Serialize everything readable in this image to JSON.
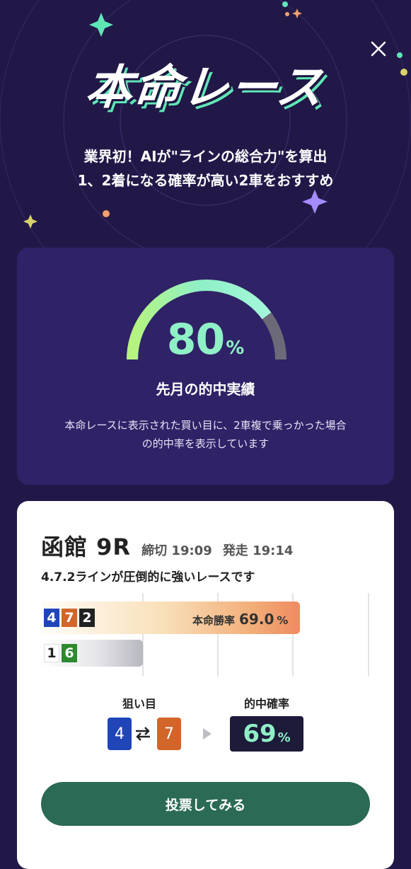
{
  "hero": {
    "title": "本命レース",
    "subtitle_line1": "業界初！AIが\"ラインの総合力\"を算出",
    "subtitle_line2": "1、2着になる確率が高い2車をおすすめ"
  },
  "stats": {
    "hit_rate": 80,
    "hit_rate_text": "80",
    "hit_rate_unit": "%",
    "label": "先月の的中実績",
    "note_line1": "本命レースに表示された買い目に、2車複で乗っかった場合",
    "note_line2": "の的中率を表示しています"
  },
  "race": {
    "venue": "函館 9R",
    "deadline": "締切 19:09",
    "start": "発走 19:14",
    "description": "4.7.2ラインが圧倒的に強いレースです",
    "lines": [
      {
        "numbers": [
          "4",
          "7",
          "2"
        ],
        "win_rate_label": "本命勝率",
        "win_rate_value": "69.0",
        "win_rate_unit": "%"
      },
      {
        "numbers": [
          "1",
          "6"
        ]
      }
    ],
    "target_label": "狙い目",
    "target_pair": [
      "4",
      "7"
    ],
    "probability_label": "的中確率",
    "probability_value": "69",
    "probability_unit": "%",
    "vote_button": "投票してみる"
  },
  "colors": {
    "background": "#221848",
    "stat_card": "#2f2267",
    "accent_green": "#8ff0c6",
    "bike_1": "#ffffff",
    "bike_2": "#222222",
    "bike_4": "#1f45b8",
    "bike_6": "#2e8a2e",
    "bike_7": "#d2652a",
    "vote_button": "#2b6a55"
  },
  "icons": {
    "close": "close-icon",
    "swap": "swap-arrows-icon",
    "next": "play-arrow-icon"
  }
}
